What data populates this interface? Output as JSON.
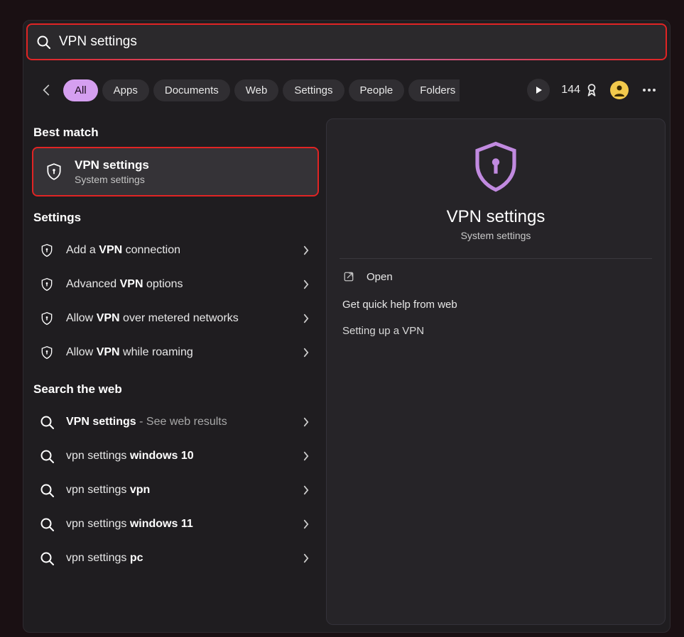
{
  "search": {
    "value": "VPN settings"
  },
  "filters": {
    "items": [
      "All",
      "Apps",
      "Documents",
      "Web",
      "Settings",
      "People",
      "Folders"
    ],
    "points": "144"
  },
  "left": {
    "best_match_title": "Best match",
    "best": {
      "title": "VPN settings",
      "subtitle": "System settings"
    },
    "settings_title": "Settings",
    "settings": [
      {
        "pre": "Add a ",
        "bold": "VPN",
        "post": " connection"
      },
      {
        "pre": "Advanced ",
        "bold": "VPN",
        "post": " options"
      },
      {
        "pre": "Allow ",
        "bold": "VPN",
        "post": " over metered networks"
      },
      {
        "pre": "Allow ",
        "bold": "VPN",
        "post": " while roaming"
      }
    ],
    "web_title": "Search the web",
    "web": [
      {
        "bold": "VPN settings",
        "grey": " - See web results"
      },
      {
        "pre": "vpn settings ",
        "bold": "windows 10"
      },
      {
        "pre": "vpn settings ",
        "bold": "vpn"
      },
      {
        "pre": "vpn settings ",
        "bold": "windows 11"
      },
      {
        "pre": "vpn settings ",
        "bold": "pc"
      }
    ]
  },
  "preview": {
    "title": "VPN settings",
    "subtitle": "System settings",
    "open": "Open",
    "help_header": "Get quick help from web",
    "help_link": "Setting up a VPN"
  }
}
